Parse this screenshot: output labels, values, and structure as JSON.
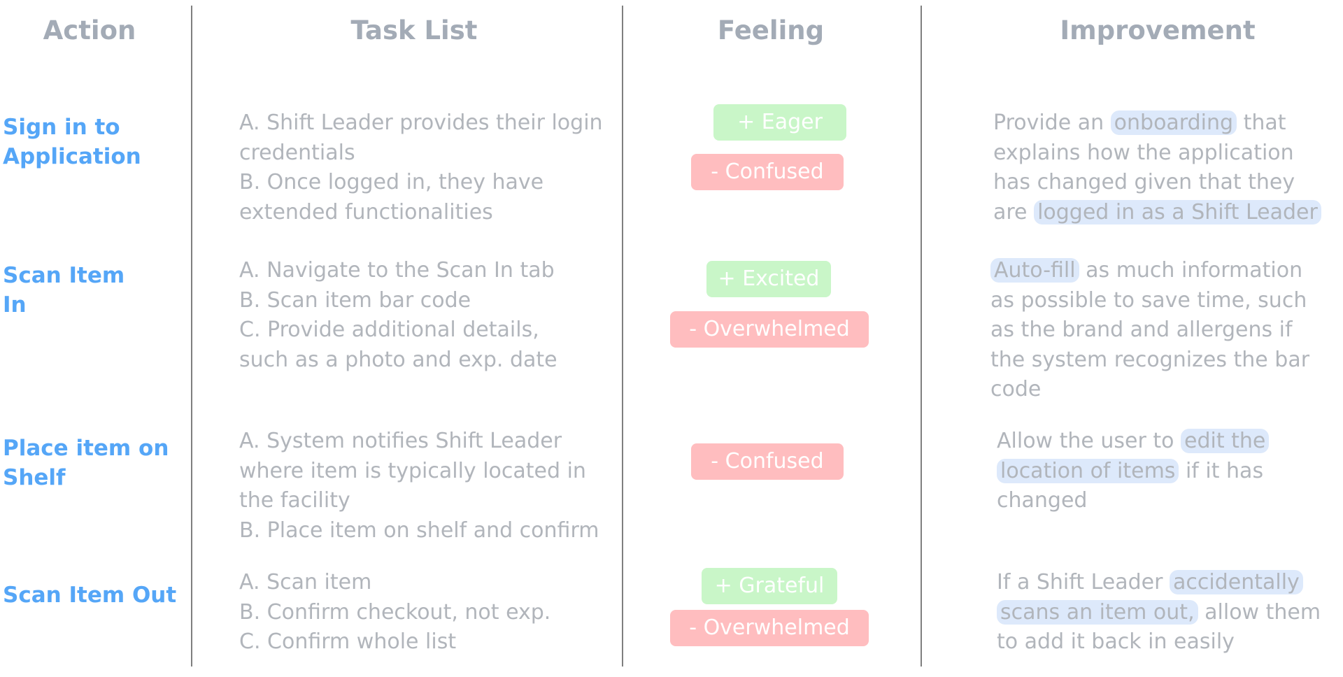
{
  "headers": {
    "action": "Action",
    "task_list": "Task List",
    "feeling": "Feeling",
    "improvement": "Improvement"
  },
  "rows": [
    {
      "action": [
        "Sign in to",
        "Application"
      ],
      "tasks": [
        "A. Shift Leader provides their login",
        "credentials",
        "B. Once logged in, they have",
        "extended functionalities"
      ],
      "feelings": [
        {
          "label": "+ Eager",
          "type": "positive"
        },
        {
          "label": "- Confused",
          "type": "negative"
        }
      ],
      "improvement": {
        "segments": [
          [
            "Provide an ",
            "onboarding",
            " that"
          ],
          [
            "explains how the application"
          ],
          [
            "has changed given that they"
          ],
          [
            "are ",
            "logged in as a Shift Leader"
          ]
        ]
      }
    },
    {
      "action": [
        "Scan Item",
        "In"
      ],
      "tasks": [
        "A. Navigate to the Scan In tab",
        "B. Scan item bar code",
        "C. Provide additional details,",
        "such as a photo and exp. date"
      ],
      "feelings": [
        {
          "label": "+ Excited",
          "type": "positive"
        },
        {
          "label": "- Overwhelmed",
          "type": "negative"
        }
      ],
      "improvement": {
        "segments": [
          [
            "Auto-fill",
            " as much information"
          ],
          [
            "as possible to save time, such"
          ],
          [
            "as the brand and allergens if"
          ],
          [
            "the system recognizes the bar"
          ],
          [
            "code"
          ]
        ]
      }
    },
    {
      "action": [
        "Place item on",
        "Shelf"
      ],
      "tasks": [
        "A. System notifies Shift Leader",
        "where item is typically located in",
        "the facility",
        "B. Place item on shelf and confirm"
      ],
      "feelings": [
        {
          "label": "- Confused",
          "type": "negative"
        }
      ],
      "improvement": {
        "segments": [
          [
            "Allow the user to ",
            "edit the"
          ],
          [
            "location of items",
            " if it has"
          ],
          [
            "changed"
          ]
        ]
      }
    },
    {
      "action": [
        "Scan Item Out"
      ],
      "tasks": [
        "A. Scan item",
        "B. Confirm checkout, not exp.",
        "C. Confirm whole list"
      ],
      "feelings": [
        {
          "label": "+ Grateful",
          "type": "positive"
        },
        {
          "label": "- Overwhelmed",
          "type": "negative"
        }
      ],
      "improvement": {
        "segments": [
          [
            "If a Shift Leader ",
            "accidentally"
          ],
          [
            "scans an item out,",
            " allow them"
          ],
          [
            "to add it back in easily"
          ]
        ]
      }
    }
  ],
  "colors": {
    "action_text": "#55a6f7",
    "header_text": "#a3abb6",
    "body_text": "#b1b5bb",
    "positive_bg": "#c9f6c8",
    "negative_bg": "#ffbdbf",
    "highlight_bg": "#dde9fb"
  }
}
